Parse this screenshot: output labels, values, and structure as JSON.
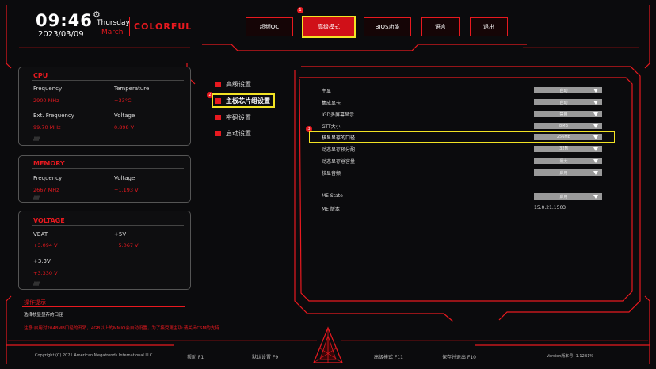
{
  "header": {
    "time": "09:46",
    "date": "2023/03/09",
    "day": "Thursday",
    "month": "March",
    "brand": "COLORFUL"
  },
  "nav": {
    "tabs": [
      {
        "label": "超频OC",
        "active": false
      },
      {
        "label": "高级模式",
        "active": true
      },
      {
        "label": "BIOS功能",
        "active": false
      },
      {
        "label": "语言",
        "active": false
      },
      {
        "label": "退出",
        "active": false
      }
    ],
    "badge": "1"
  },
  "cpu": {
    "title": "CPU",
    "frequency_label": "Frequency",
    "frequency_value": "2900 MHz",
    "temperature_label": "Temperature",
    "temperature_value": "+33°C",
    "ext_freq_label": "Ext. Frequency",
    "ext_freq_value": "99.70 MHz",
    "voltage_label": "Voltage",
    "voltage_value": "0.898 V"
  },
  "memory": {
    "title": "MEMORY",
    "frequency_label": "Frequency",
    "frequency_value": "2667 MHz",
    "voltage_label": "Voltage",
    "voltage_value": "+1.193 V"
  },
  "voltage": {
    "title": "VOLTAGE",
    "vbat_label": "VBAT",
    "vbat_value": "+3.094 V",
    "v5_label": "+5V",
    "v5_value": "+5.067 V",
    "v33_label": "+3.3V",
    "v33_value": "+3.330 V"
  },
  "operation": {
    "title": "操作提示",
    "text": "选择核显显存的口径",
    "note": "注意:启用对2048MB口径的开销，4GB以上的MMIO会自动设置，为了接受更主功:请关闭CSM的支持."
  },
  "menu": {
    "items": [
      {
        "label": "高级设置",
        "selected": false
      },
      {
        "label": "主板芯片组设置",
        "selected": true
      },
      {
        "label": "密码设置",
        "selected": false
      },
      {
        "label": "启动设置",
        "selected": false
      }
    ],
    "badge": "2"
  },
  "settings": {
    "rows": [
      {
        "label": "主显",
        "value": "自动"
      },
      {
        "label": "集成显卡",
        "value": "自动"
      },
      {
        "label": "IGD多屏幕显示",
        "value": "禁用"
      },
      {
        "label": "GTT大小",
        "value": "8MB"
      },
      {
        "label": "核显显存的口径",
        "value": "256MB"
      },
      {
        "label": "动态显存预分配",
        "value": "32M"
      },
      {
        "label": "动态显存总容量",
        "value": "最大"
      },
      {
        "label": "核显音频",
        "value": "启用"
      }
    ],
    "me_state_label": "ME State",
    "me_state_value": "启用",
    "me_version_label": "ME 版本",
    "me_version_value": "15.0.21.1503",
    "badge": "3"
  },
  "footer": {
    "copyright": "Copyright (C) 2021 American Megatrends International LLC",
    "keys": [
      "帮助 F1",
      "默认设置 F9",
      "高级模式 F11",
      "保存并退出 F10"
    ],
    "version": "Version版本号: 1.12B1%"
  },
  "colors": {
    "accent": "#e8191f",
    "highlight": "#f2e324",
    "background": "#0b0b0d"
  }
}
